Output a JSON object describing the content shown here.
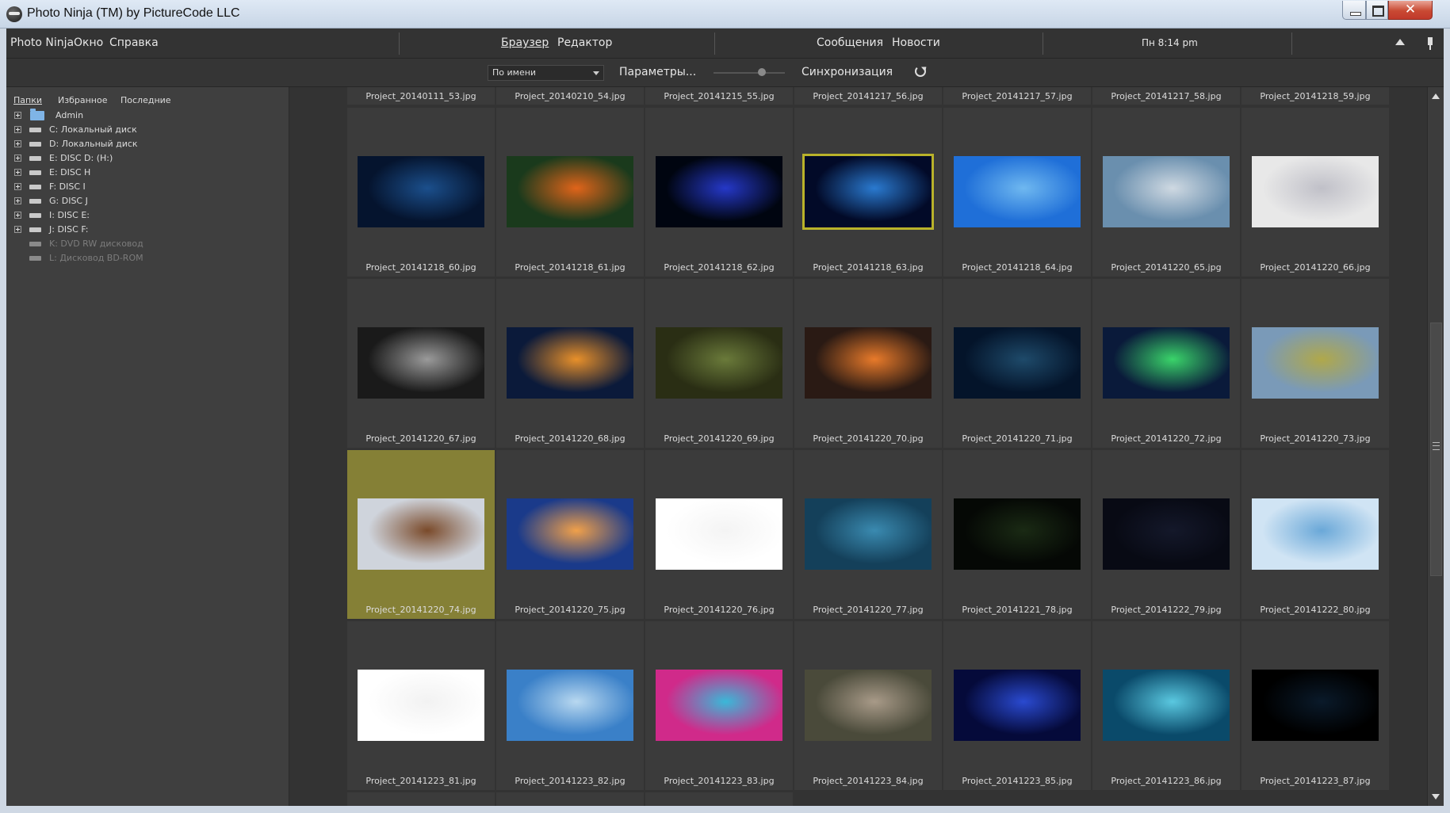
{
  "window": {
    "title": "Photo Ninja (TM) by PictureCode LLC",
    "close_glyph": "✕"
  },
  "menubar": {
    "app_menu": "Photo Ninja",
    "window_menu": "Окно",
    "help_menu": "Справка",
    "tab_browser": "Браузер",
    "tab_editor": "Редактор",
    "messages": "Сообщения",
    "news": "Новости",
    "clock": "Пн 8:14 pm"
  },
  "toolbar": {
    "sort_value": "По имени",
    "params_label": "Параметры...",
    "sync_label": "Синхронизация",
    "thumb_size_fraction": 0.7
  },
  "left_panel": {
    "tabs": [
      "Папки",
      "Избранное",
      "Последние"
    ],
    "tree": [
      {
        "label": "Admin",
        "type": "folder",
        "expandable": true,
        "enabled": true
      },
      {
        "label": "C:  Локальный диск",
        "type": "drive",
        "expandable": true,
        "enabled": true
      },
      {
        "label": "D:  Локальный диск",
        "type": "drive",
        "expandable": true,
        "enabled": true
      },
      {
        "label": "E:  DISC D:  (H:)",
        "type": "drive",
        "expandable": true,
        "enabled": true
      },
      {
        "label": "E:  DISC H",
        "type": "drive",
        "expandable": true,
        "enabled": true
      },
      {
        "label": "F:  DISC I",
        "type": "drive",
        "expandable": true,
        "enabled": true
      },
      {
        "label": "G:  DISC J",
        "type": "drive",
        "expandable": true,
        "enabled": true
      },
      {
        "label": "I:  DISC E:",
        "type": "drive",
        "expandable": true,
        "enabled": true
      },
      {
        "label": "J:  DISC F:",
        "type": "drive",
        "expandable": true,
        "enabled": true
      },
      {
        "label": "K:  DVD RW дисковод",
        "type": "drive",
        "expandable": false,
        "enabled": false
      },
      {
        "label": "L:  Дисковод BD-ROM",
        "type": "drive",
        "expandable": false,
        "enabled": false
      }
    ]
  },
  "grid": {
    "top_row": [
      "Project_20140111_53.jpg",
      "Project_20140210_54.jpg",
      "Project_20141215_55.jpg",
      "Project_20141217_56.jpg",
      "Project_20141217_57.jpg",
      "Project_20141217_58.jpg",
      "Project_20141218_59.jpg"
    ],
    "rows": [
      [
        {
          "name": "Project_20141218_60.jpg",
          "colors": [
            "#05142e",
            "#1b4f8c",
            "#0a2344"
          ]
        },
        {
          "name": "Project_20141218_61.jpg",
          "colors": [
            "#1a3a1c",
            "#e0641a",
            "#5a7a3a"
          ]
        },
        {
          "name": "Project_20141218_62.jpg",
          "colors": [
            "#000510",
            "#2538c8",
            "#5a7aff"
          ]
        },
        {
          "name": "Project_20141218_63.jpg",
          "colors": [
            "#020a28",
            "#2a7ad0",
            "#88c8ff"
          ],
          "framed": true
        },
        {
          "name": "Project_20141218_64.jpg",
          "colors": [
            "#1f6fd8",
            "#6fb8f0",
            "#2a9a2a"
          ]
        },
        {
          "name": "Project_20141220_65.jpg",
          "colors": [
            "#6a8fae",
            "#cfd9e2",
            "#ffffff"
          ]
        },
        {
          "name": "Project_20141220_66.jpg",
          "colors": [
            "#e8e8e8",
            "#c0c0c8",
            "#f4f4f4"
          ]
        }
      ],
      [
        {
          "name": "Project_20141220_67.jpg",
          "colors": [
            "#1a1a1a",
            "#9a9a9a",
            "#cfcfcf"
          ]
        },
        {
          "name": "Project_20141220_68.jpg",
          "colors": [
            "#0b1a3a",
            "#e8902a",
            "#14325a"
          ]
        },
        {
          "name": "Project_20141220_69.jpg",
          "colors": [
            "#2a2e14",
            "#6a7a3a",
            "#141a0a"
          ]
        },
        {
          "name": "Project_20141220_70.jpg",
          "colors": [
            "#2a1a14",
            "#e87a2a",
            "#180c08"
          ]
        },
        {
          "name": "Project_20141220_71.jpg",
          "colors": [
            "#04142a",
            "#1e4a6a",
            "#2a5a7a"
          ]
        },
        {
          "name": "Project_20141220_72.jpg",
          "colors": [
            "#0a1a3a",
            "#3ad46a",
            "#101830"
          ]
        },
        {
          "name": "Project_20141220_73.jpg",
          "colors": [
            "#7a9ab8",
            "#b0a84a",
            "#3a3a2a"
          ]
        }
      ],
      [
        {
          "name": "Project_20141220_74.jpg",
          "colors": [
            "#cfd4dc",
            "#7a4a2a",
            "#a0a8b4"
          ],
          "selected": true
        },
        {
          "name": "Project_20141220_75.jpg",
          "colors": [
            "#1a3a8a",
            "#f0a04a",
            "#2a2a5a"
          ]
        },
        {
          "name": "Project_20141220_76.jpg",
          "colors": [
            "#ffffff",
            "#f4f4f4",
            "#e8ffe0"
          ]
        },
        {
          "name": "Project_20141220_77.jpg",
          "colors": [
            "#14405a",
            "#3a8ab0",
            "#0a2438"
          ]
        },
        {
          "name": "Project_20141221_78.jpg",
          "colors": [
            "#050805",
            "#1a2a14",
            "#000000"
          ]
        },
        {
          "name": "Project_20141222_79.jpg",
          "colors": [
            "#080a14",
            "#14182a",
            "#b06a2a"
          ]
        },
        {
          "name": "Project_20141222_80.jpg",
          "colors": [
            "#d0e4f4",
            "#6aa8d8",
            "#f0f4f8"
          ]
        }
      ],
      [
        {
          "name": "Project_20141223_81.jpg",
          "colors": [
            "#ffffff",
            "#f2f2f2",
            "#e0e0e0"
          ]
        },
        {
          "name": "Project_20141223_82.jpg",
          "colors": [
            "#3a80c8",
            "#b8d8f0",
            "#2a68b0"
          ]
        },
        {
          "name": "Project_20141223_83.jpg",
          "colors": [
            "#d02a8a",
            "#3ab8d8",
            "#8a3ad0"
          ]
        },
        {
          "name": "Project_20141223_84.jpg",
          "colors": [
            "#4a4a3a",
            "#a89a88",
            "#6a3a4a"
          ]
        },
        {
          "name": "Project_20141223_85.jpg",
          "colors": [
            "#050a3a",
            "#2a4ad0",
            "#0a1460"
          ]
        },
        {
          "name": "Project_20141223_86.jpg",
          "colors": [
            "#0a4a6a",
            "#5ac8e0",
            "#0a6a8a"
          ]
        },
        {
          "name": "Project_20141223_87.jpg",
          "colors": [
            "#000000",
            "#0a1a2a",
            "#2ab07a"
          ]
        }
      ]
    ],
    "bottom_row_visible": 3
  },
  "colors": {
    "selection": "#858036",
    "frame_highlight": "#b9b22a",
    "background": "#333333"
  }
}
